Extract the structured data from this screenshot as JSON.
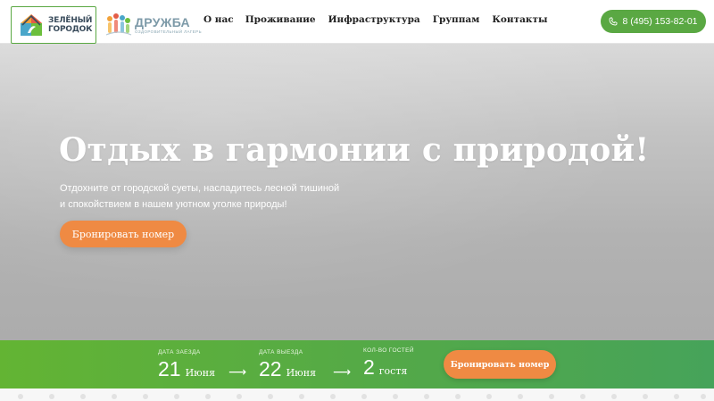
{
  "header": {
    "logo_primary": {
      "line1": "ЗЕЛЁНЫЙ",
      "line2": "ГОРОДОК"
    },
    "logo_secondary": {
      "title": "ДРУЖБА",
      "subtitle": "ОЗДОРОВИТЕЛЬНЫЙ ЛАГЕРЬ"
    },
    "nav": [
      {
        "label": "О нас"
      },
      {
        "label": "Проживание"
      },
      {
        "label": "Инфраструктура"
      },
      {
        "label": "Группам"
      },
      {
        "label": "Контакты"
      }
    ],
    "phone": "8 (495) 153-82-01"
  },
  "hero": {
    "title": "Отдых в гармонии с природой!",
    "subtitle_line1": "Отдохните от городской суеты, насладитесь лесной тишиной",
    "subtitle_line2": "и спокойствием в нашем уютном уголке природы!",
    "cta": "Бронировать номер"
  },
  "booking": {
    "checkin": {
      "label": "ДАТА ЗАЕЗДА",
      "day": "21",
      "month": "Июня"
    },
    "checkout": {
      "label": "ДАТА ВЫЕЗДА",
      "day": "22",
      "month": "Июня"
    },
    "guests": {
      "label": "КОЛ-ВО ГОСТЕЙ",
      "count": "2",
      "unit": "гостя"
    },
    "arrow": "⟶",
    "button": "Бронировать номер"
  },
  "colors": {
    "brand_green": "#5aa843",
    "accent_orange": "#ef8a43",
    "booking_bar": "#52a84a"
  },
  "icons": {
    "logo_house": "house-logo-icon",
    "logo_children": "children-logo-icon",
    "phone": "phone-icon"
  }
}
